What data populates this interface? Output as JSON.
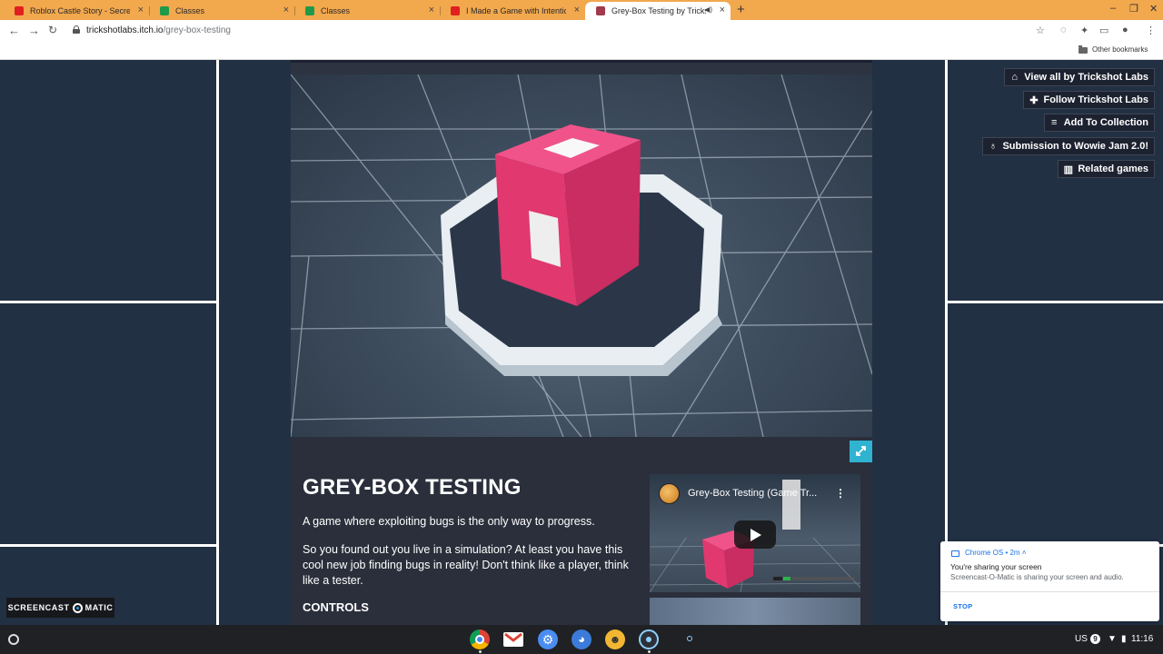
{
  "browser": {
    "tabs": [
      {
        "label": "Roblox Castle Story - Secret End",
        "favicon": "youtube-icon",
        "active": false
      },
      {
        "label": "Classes",
        "favicon": "classroom-icon",
        "active": false
      },
      {
        "label": "Classes",
        "favicon": "classroom-icon",
        "active": false
      },
      {
        "label": "I Made a Game with Intentional",
        "favicon": "youtube-icon",
        "active": false
      },
      {
        "label": "Grey-Box Testing by Tricksho",
        "favicon": "itch-icon",
        "active": true
      }
    ],
    "new_tab_glyph": "+",
    "close_glyph": "×",
    "url_host": "trickshotlabs.itch.io",
    "url_path": "/grey-box-testing",
    "bookmarks_folder": "Other bookmarks"
  },
  "page": {
    "actions": [
      {
        "label": "View all by Trickshot Labs",
        "icon": "store-icon"
      },
      {
        "label": "Follow Trickshot Labs",
        "icon": "follow-user-icon"
      },
      {
        "label": "Add To Collection",
        "icon": "playlist-add-icon"
      },
      {
        "label": "Submission to Wowie Jam 2.0!",
        "icon": "award-icon"
      },
      {
        "label": "Related games",
        "icon": "map-icon"
      }
    ],
    "game": {
      "title": "GREY-BOX TESTING",
      "tagline": "A game where exploiting bugs is the only way to progress.",
      "description": "So you found out you live in a simulation? At least you have this cool new job finding bugs in reality! Don't think like a player, think like a tester.",
      "controls_heading": "CONTROLS"
    },
    "video": {
      "title": "Grey-Box Testing (Game Tr..."
    },
    "accent_color": "#2fb3d1",
    "cube_color": "#e0386f"
  },
  "overlay": {
    "recorder_badge": {
      "left": "SCREENCAST",
      "right": "MATIC"
    },
    "notification": {
      "source": "Chrome OS",
      "time": "2m",
      "title": "You're sharing your screen",
      "body": "Screencast-O-Matic is sharing your screen and audio.",
      "action": "STOP"
    }
  },
  "shelf": {
    "apps": [
      "chrome-icon",
      "gmail-icon",
      "settings-icon",
      "palette-icon",
      "game-app-icon",
      "screencast-icon"
    ],
    "locale": "US",
    "notification_count": "9",
    "time": "11:16"
  }
}
